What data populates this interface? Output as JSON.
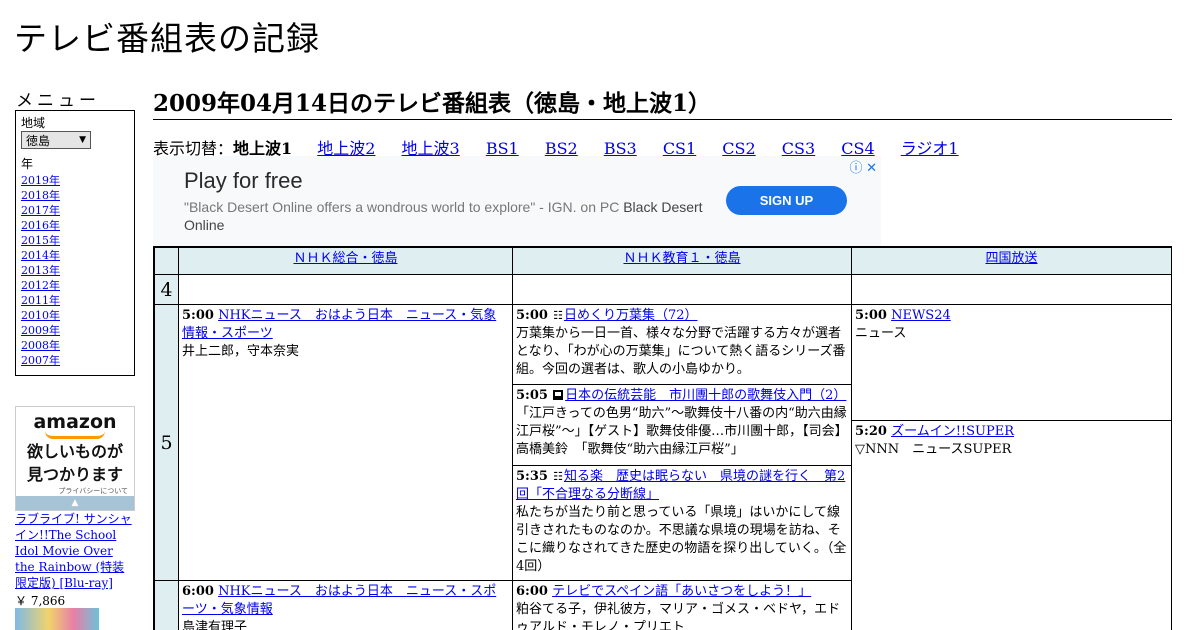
{
  "site": {
    "title": "テレビ番組表の記録"
  },
  "sidebar": {
    "menu_heading": "メニュー",
    "region_label": "地域",
    "region_value": "徳島",
    "year_label": "年",
    "years": [
      "2019年",
      "2018年",
      "2017年",
      "2016年",
      "2015年",
      "2014年",
      "2013年",
      "2012年",
      "2011年",
      "2010年",
      "2009年",
      "2008年",
      "2007年"
    ]
  },
  "amazon_ad": {
    "logo": "amazon",
    "tagline_1": "欲しいものが",
    "tagline_2": "見つかります",
    "privacy": "プライバシーについて",
    "product_title": "ラブライブ! サンシャイン!!The School Idol Movie Over the Rainbow (特装限定版) [Blu-ray]",
    "product_price": "￥ 7,866"
  },
  "main": {
    "heading": "2009年04月14日のテレビ番組表（徳島・地上波1）",
    "switch_label": "表示切替：",
    "current_view": "地上波1",
    "views": [
      "地上波2",
      "地上波3",
      "BS1",
      "BS2",
      "BS3",
      "CS1",
      "CS2",
      "CS3",
      "CS4",
      "ラジオ1"
    ]
  },
  "ad": {
    "headline": "Play for free",
    "body": "\"Black Desert Online offers a wondrous world to explore\" - IGN. on PC",
    "advertiser": "Black Desert Online",
    "cta": "SIGN UP",
    "info_icon": "ⓘ",
    "close_icon": "✕"
  },
  "schedule": {
    "channels": [
      "ＮＨＫ総合・徳島",
      "ＮＨＫ教育１・徳島",
      "四国放送"
    ],
    "hours": [
      "4",
      "5",
      ""
    ],
    "programs": {
      "ch1_0500": {
        "time": "5:00",
        "title": "NHKニュース　おはよう日本　ニュース・気象情報・スポーツ",
        "desc": "井上二郎，守本奈実"
      },
      "ch1_0600": {
        "time": "6:00",
        "title": "NHKニュース　おはよう日本　ニュース・スポーツ・気象情報",
        "desc": "島津有理子"
      },
      "ch2_0500": {
        "time": "5:00",
        "title": "日めくり万葉集（72）",
        "desc": "万葉集から一日一首、様々な分野で活躍する方々が選者となり、「わが心の万葉集」について熱く語るシリーズ番組。今回の選者は、歌人の小島ゆかり。"
      },
      "ch2_0505": {
        "time": "5:05",
        "title": "日本の伝統芸能　市川團十郎の歌舞伎入門（2）",
        "desc": "「江戸きっての色男“助六”～歌舞伎十八番の内“助六由縁江戸桜”～」【ゲスト】歌舞伎俳優…市川團十郎，【司会】高橋美鈴　「歌舞伎“助六由縁江戸桜”」"
      },
      "ch2_0535": {
        "time": "5:35",
        "title": "知る楽　歴史は眠らない　県境の謎を行く　第2回「不合理なる分断線」",
        "desc": "私たちが当たり前と思っている「県境」はいかにして線引きされたものなのか。不思議な県境の現場を訪ね、そこに織りなされてきた歴史の物語を探り出していく。（全4回）"
      },
      "ch2_0600": {
        "time": "6:00",
        "title": "テレビでスペイン語「あいさつをしよう！」",
        "desc": "粕谷てる子，伊礼彼方，マリア・ゴメス・ベドヤ，エドゥアルド・モレノ・プリエト"
      },
      "ch3_0500": {
        "time": "5:00",
        "title": "NEWS24",
        "desc": "ニュース"
      },
      "ch3_0520": {
        "time": "5:20",
        "title": "ズームイン!!SUPER",
        "desc": "▽NNN　ニュースSUPER"
      }
    }
  }
}
